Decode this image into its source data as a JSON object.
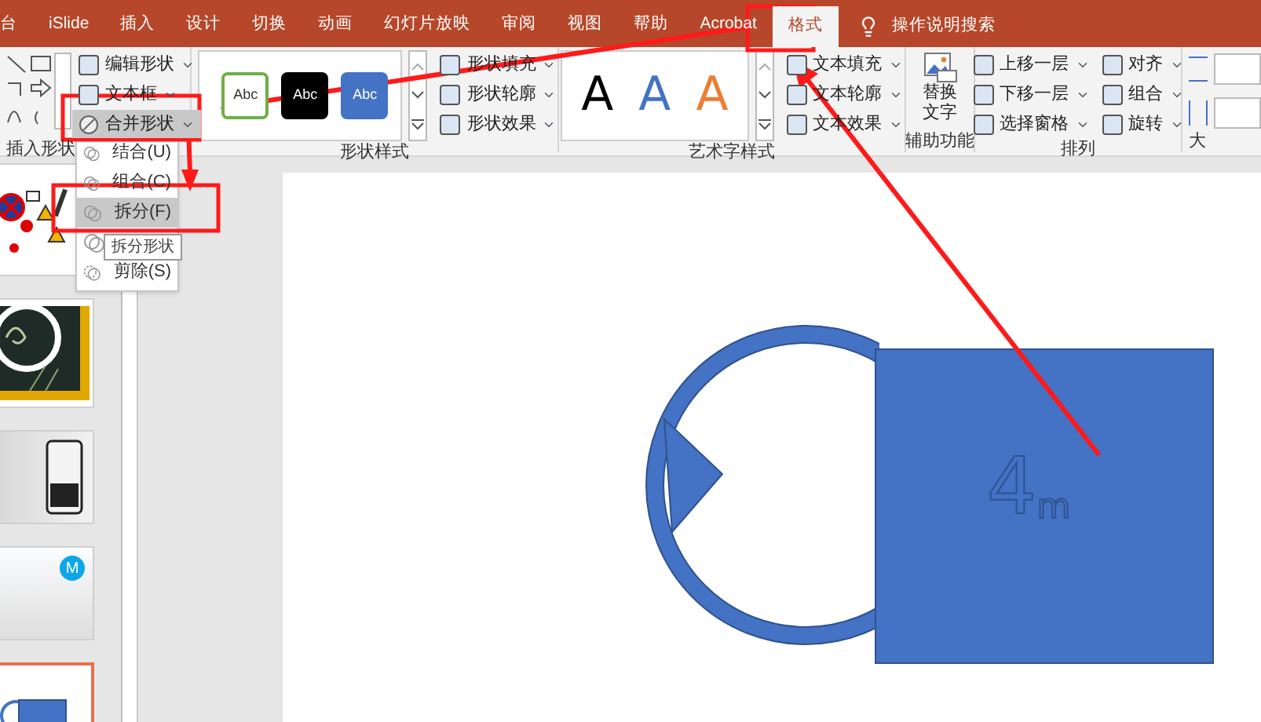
{
  "tabs": [
    {
      "label": "台",
      "selected": false
    },
    {
      "label": "iSlide",
      "selected": false
    },
    {
      "label": "插入",
      "selected": false
    },
    {
      "label": "设计",
      "selected": false
    },
    {
      "label": "切换",
      "selected": false
    },
    {
      "label": "动画",
      "selected": false
    },
    {
      "label": "幻灯片放映",
      "selected": false
    },
    {
      "label": "审阅",
      "selected": false
    },
    {
      "label": "视图",
      "selected": false
    },
    {
      "label": "帮助",
      "selected": false
    },
    {
      "label": "Acrobat",
      "selected": false
    },
    {
      "label": "格式",
      "selected": true
    }
  ],
  "search": {
    "placeholder": "操作说明搜索"
  },
  "ribbon": [
    {
      "kind": "insert_shapes",
      "label": "插入形状",
      "commands": [
        "编辑形状",
        "文本框"
      ],
      "merge_button": {
        "text": "合并形状",
        "open": true
      }
    },
    {
      "kind": "shape_styles",
      "label": "形状样式",
      "swatches": [
        {
          "text": "Abc",
          "color": "#ffffff"
        },
        {
          "text": "Abc",
          "color": "#000000"
        },
        {
          "text": "Abc",
          "color": "#4472c4"
        }
      ],
      "commands": [
        "形状填充",
        "形状轮廓",
        "形状效果"
      ]
    },
    {
      "kind": "wordart",
      "label": "艺术字样式",
      "letters": [
        {
          "text": "A",
          "color": "#000000"
        },
        {
          "text": "A",
          "color": "#4472c4"
        },
        {
          "text": "A",
          "color": "#ed7d31"
        }
      ],
      "commands": [
        "文本填充",
        "文本轮廓",
        "文本效果"
      ]
    },
    {
      "kind": "alt_text",
      "label": "辅助功能",
      "button": "替换文字"
    },
    {
      "kind": "arrange",
      "label": "排列",
      "commands": [
        "上移一层",
        "下移一层",
        "选择窗格",
        "对齐",
        "组合",
        "旋转"
      ]
    },
    {
      "kind": "size",
      "label": "大"
    }
  ],
  "merge_menu": {
    "items": [
      {
        "text": "结合(U)",
        "selected": false
      },
      {
        "text": "组合(C)",
        "selected": false
      },
      {
        "text": "拆分(F)",
        "selected": true
      },
      {
        "selected": false
      },
      {
        "text": "剪除(S)",
        "selected": false
      }
    ],
    "tooltip": "拆分形状"
  },
  "slides": [
    {
      "kind": "icons",
      "selected": false
    },
    {
      "kind": "picture",
      "selected": false
    },
    {
      "kind": "phone",
      "selected": false
    },
    {
      "kind": "badge",
      "badge": "M",
      "selected": false
    },
    {
      "kind": "shapes",
      "selected": true
    }
  ],
  "canvas": {
    "number": "4",
    "unit": "m"
  }
}
